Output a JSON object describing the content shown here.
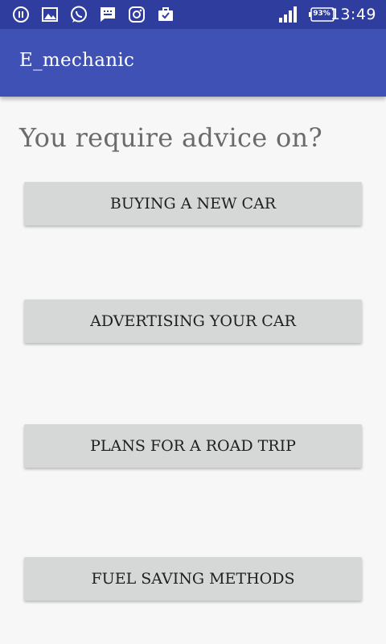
{
  "status_bar": {
    "battery_percent": "93%",
    "time": "13:49",
    "icons": [
      "pause-icon",
      "gallery-icon",
      "whatsapp-icon",
      "message-icon",
      "instagram-icon",
      "briefcase-check-icon",
      "signal-icon",
      "battery-icon"
    ]
  },
  "app_bar": {
    "title": "E_mechanic",
    "color": "#3f51b5"
  },
  "main": {
    "heading": "You require advice on?",
    "buttons": [
      {
        "label": "BUYING A NEW CAR"
      },
      {
        "label": "ADVERTISING YOUR CAR"
      },
      {
        "label": "PLANS FOR A ROAD TRIP"
      },
      {
        "label": "FUEL SAVING METHODS"
      }
    ]
  }
}
